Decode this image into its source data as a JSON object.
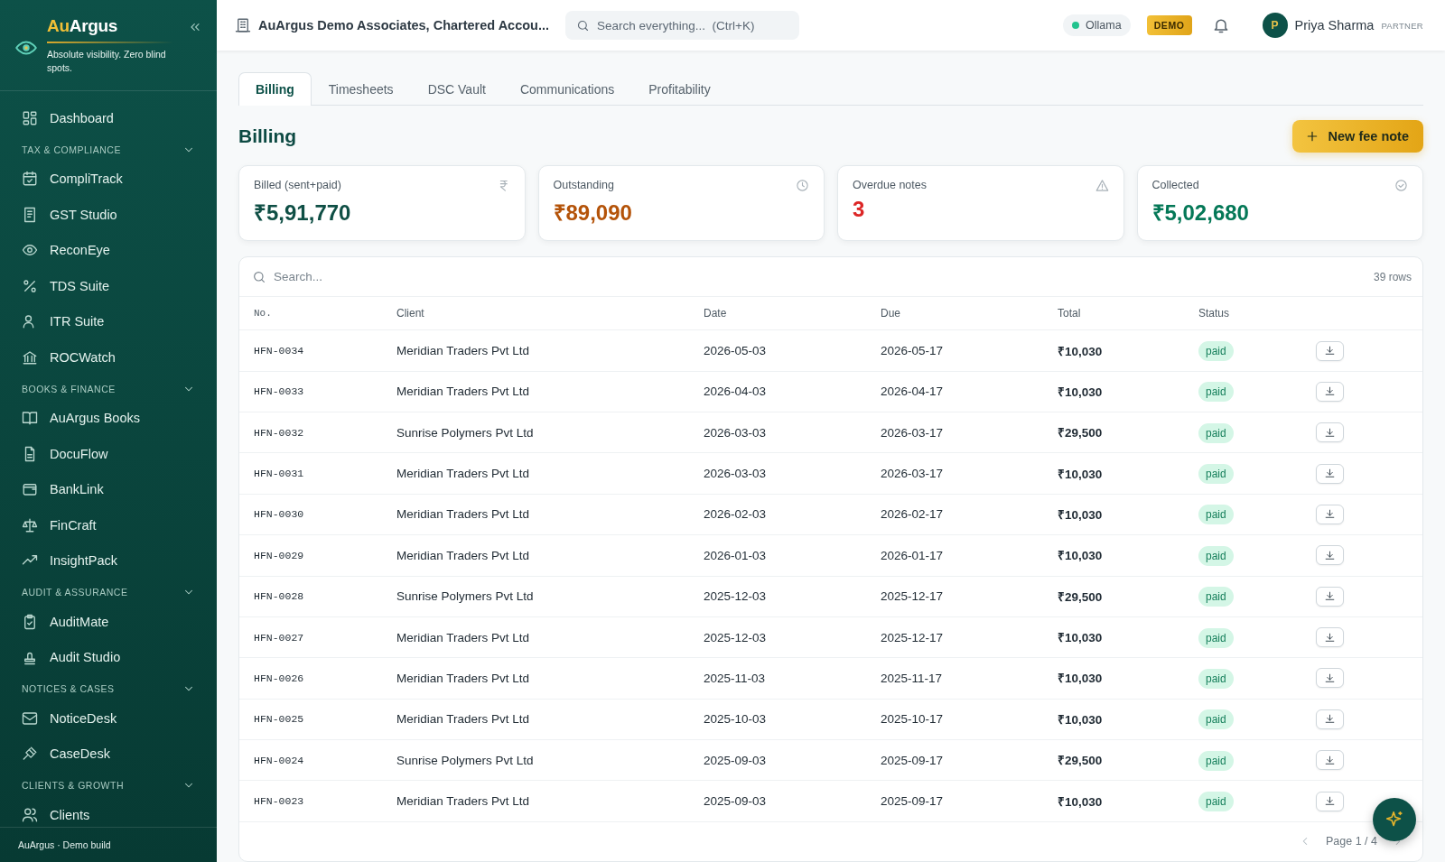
{
  "sidebar": {
    "brand_prefix": "Au",
    "brand_suffix": "Argus",
    "tagline": "Absolute visibility. Zero blind spots.",
    "nav": [
      {
        "kind": "item",
        "label": "Dashboard"
      },
      {
        "kind": "group",
        "label": "TAX & COMPLIANCE",
        "expanded": true,
        "children": [
          {
            "label": "CompliTrack"
          },
          {
            "label": "GST Studio"
          },
          {
            "label": "ReconEye"
          },
          {
            "label": "TDS Suite"
          },
          {
            "label": "ITR Suite"
          },
          {
            "label": "ROCWatch"
          }
        ]
      },
      {
        "kind": "group",
        "label": "BOOKS & FINANCE",
        "expanded": true,
        "children": [
          {
            "label": "AuArgus Books"
          },
          {
            "label": "DocuFlow"
          },
          {
            "label": "BankLink"
          },
          {
            "label": "FinCraft"
          },
          {
            "label": "InsightPack"
          }
        ]
      },
      {
        "kind": "group",
        "label": "AUDIT & ASSURANCE",
        "expanded": true,
        "children": [
          {
            "label": "AuditMate"
          },
          {
            "label": "Audit Studio"
          }
        ]
      },
      {
        "kind": "group",
        "label": "NOTICES & CASES",
        "expanded": true,
        "children": [
          {
            "label": "NoticeDesk"
          },
          {
            "label": "CaseDesk"
          }
        ]
      },
      {
        "kind": "group",
        "label": "CLIENTS & GROWTH",
        "expanded": true,
        "children": [
          {
            "label": "Clients"
          }
        ]
      }
    ],
    "footer": "AuArgus · Demo build"
  },
  "topbar": {
    "firm": "AuArgus Demo Associates, Chartered Accou...",
    "search": {
      "placeholder": "Search everything...  (Ctrl+K)"
    },
    "ai_status": {
      "label": "Ollama",
      "online": true
    },
    "badge": "DEMO",
    "user": {
      "initial": "P",
      "name": "Priya Sharma",
      "role": "PARTNER"
    }
  },
  "tabs": [
    {
      "label": "Billing",
      "selected": true
    },
    {
      "label": "Timesheets",
      "selected": false
    },
    {
      "label": "DSC Vault",
      "selected": false
    },
    {
      "label": "Communications",
      "selected": false
    },
    {
      "label": "Profitability",
      "selected": false
    }
  ],
  "page": {
    "title": "Billing",
    "primary_button": "New fee note"
  },
  "stats": [
    {
      "label": "Billed (sent+paid)",
      "value": "₹5,91,770",
      "color": "#0f4f45"
    },
    {
      "label": "Outstanding",
      "value": "₹89,090",
      "color": "#b45309"
    },
    {
      "label": "Overdue notes",
      "value": "3",
      "color": "#dc2626"
    },
    {
      "label": "Collected",
      "value": "₹5,02,680",
      "color": "#047857"
    }
  ],
  "table": {
    "search": {
      "placeholder": "Search..."
    },
    "row_count": "39 rows",
    "columns": [
      "No.",
      "Client",
      "Date",
      "Due",
      "Total",
      "Status"
    ],
    "rows": [
      [
        "HFN-0034",
        "Meridian Traders Pvt Ltd",
        "2026-05-03",
        "2026-05-17",
        "₹10,030",
        "paid"
      ],
      [
        "HFN-0033",
        "Meridian Traders Pvt Ltd",
        "2026-04-03",
        "2026-04-17",
        "₹10,030",
        "paid"
      ],
      [
        "HFN-0032",
        "Sunrise Polymers Pvt Ltd",
        "2026-03-03",
        "2026-03-17",
        "₹29,500",
        "paid"
      ],
      [
        "HFN-0031",
        "Meridian Traders Pvt Ltd",
        "2026-03-03",
        "2026-03-17",
        "₹10,030",
        "paid"
      ],
      [
        "HFN-0030",
        "Meridian Traders Pvt Ltd",
        "2026-02-03",
        "2026-02-17",
        "₹10,030",
        "paid"
      ],
      [
        "HFN-0029",
        "Meridian Traders Pvt Ltd",
        "2026-01-03",
        "2026-01-17",
        "₹10,030",
        "paid"
      ],
      [
        "HFN-0028",
        "Sunrise Polymers Pvt Ltd",
        "2025-12-03",
        "2025-12-17",
        "₹29,500",
        "paid"
      ],
      [
        "HFN-0027",
        "Meridian Traders Pvt Ltd",
        "2025-12-03",
        "2025-12-17",
        "₹10,030",
        "paid"
      ],
      [
        "HFN-0026",
        "Meridian Traders Pvt Ltd",
        "2025-11-03",
        "2025-11-17",
        "₹10,030",
        "paid"
      ],
      [
        "HFN-0025",
        "Meridian Traders Pvt Ltd",
        "2025-10-03",
        "2025-10-17",
        "₹10,030",
        "paid"
      ],
      [
        "HFN-0024",
        "Sunrise Polymers Pvt Ltd",
        "2025-09-03",
        "2025-09-17",
        "₹29,500",
        "paid"
      ],
      [
        "HFN-0023",
        "Meridian Traders Pvt Ltd",
        "2025-09-03",
        "2025-09-17",
        "₹10,030",
        "paid"
      ]
    ],
    "pagination": "Page 1 / 4"
  }
}
